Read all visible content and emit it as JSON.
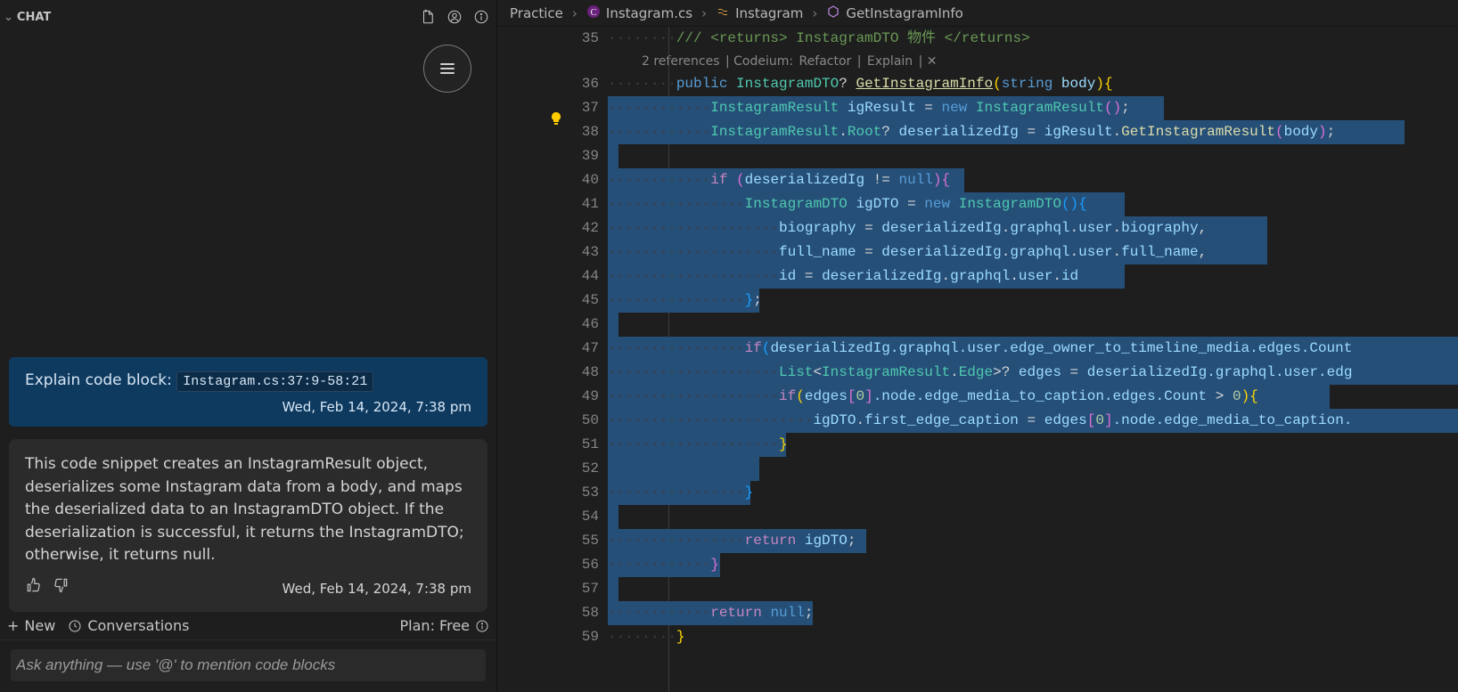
{
  "chat": {
    "header_label": "CHAT",
    "user_msg": {
      "prefix": "Explain code block:",
      "chip": "Instagram.cs:37:9-58:21",
      "timestamp": "Wed, Feb 14, 2024, 7:38 pm"
    },
    "assist_msg": {
      "text": "This code snippet creates an InstagramResult object, deserializes some Instagram data from a body, and maps the deserialized data to an InstagramDTO object. If the deserialization is successful, it returns the InstagramDTO; otherwise, it returns null.",
      "timestamp": "Wed, Feb 14, 2024, 7:38 pm"
    },
    "footer": {
      "new": "New",
      "conversations": "Conversations",
      "plan": "Plan: Free"
    },
    "input_placeholder": "Ask anything — use '@' to mention code blocks"
  },
  "breadcrumbs": {
    "b1": "Practice",
    "b2": "Instagram.cs",
    "b3": "Instagram",
    "b4": "GetInstagramInfo"
  },
  "codelens": {
    "refs": "2 references",
    "codeium": "Codeium:",
    "refactor": "Refactor",
    "explain": "Explain"
  },
  "code": {
    "gutter": [
      "35",
      "",
      "36",
      "37",
      "38",
      "39",
      "40",
      "41",
      "42",
      "43",
      "44",
      "45",
      "46",
      "47",
      "48",
      "49",
      "50",
      "51",
      "52",
      "53",
      "54",
      "55",
      "56",
      "57",
      "58",
      "59"
    ],
    "l35_comment": "/// <returns> InstagramDTO 物件 </returns>",
    "l36_public": "public",
    "l36_type": "InstagramDTO",
    "l36_q": "?",
    "l36_fn": "GetInstagramInfo",
    "l36_str": "string",
    "l36_body": "body",
    "l37_type": "InstagramResult",
    "l37_var": "igResult",
    "l37_new": "new",
    "l37_ctor": "InstagramResult",
    "l38_type": "InstagramResult",
    "l38_root": "Root",
    "l38_q": "?",
    "l38_var": "deserializedIg",
    "l38_ig": "igResult",
    "l38_fn": "GetInstagramResult",
    "l38_body": "body",
    "l40_if": "if",
    "l40_var": "deserializedIg",
    "l40_null": "null",
    "l41_type": "InstagramDTO",
    "l41_var": "igDTO",
    "l41_new": "new",
    "l41_ctor": "InstagramDTO",
    "l42_prop": "biography",
    "l42_var": "deserializedIg",
    "l42_g": "graphql",
    "l42_u": "user",
    "l42_b": "biography",
    "l43_prop": "full_name",
    "l43_var": "deserializedIg",
    "l43_g": "graphql",
    "l43_u": "user",
    "l43_f": "full_name",
    "l44_prop": "id",
    "l44_var": "deserializedIg",
    "l44_g": "graphql",
    "l44_u": "user",
    "l44_i": "id",
    "l47_if": "if",
    "l47_var": "deserializedIg",
    "l47_path": ".graphql.user.edge_owner_to_timeline_media.edges.Count",
    "l48_list": "List",
    "l48_edge": "InstagramResult",
    "l48_edgeT": "Edge",
    "l48_q": "?",
    "l48_var": "edges",
    "l48_r": "deserializedIg",
    "l48_path": ".graphql.user.edg",
    "l49_if": "if",
    "l49_var": "edges",
    "l49_i": "0",
    "l49_path": ".node.edge_media_to_caption.edges.Count",
    "l49_gt": ">",
    "l49_z": "0",
    "l50_var": "igDTO",
    "l50_p": "first_edge_caption",
    "l50_e": "edges",
    "l50_i": "0",
    "l50_path": ".node.edge_media_to_caption.",
    "l55_return": "return",
    "l55_var": "igDTO",
    "l58_return": "return",
    "l58_null": "null"
  }
}
